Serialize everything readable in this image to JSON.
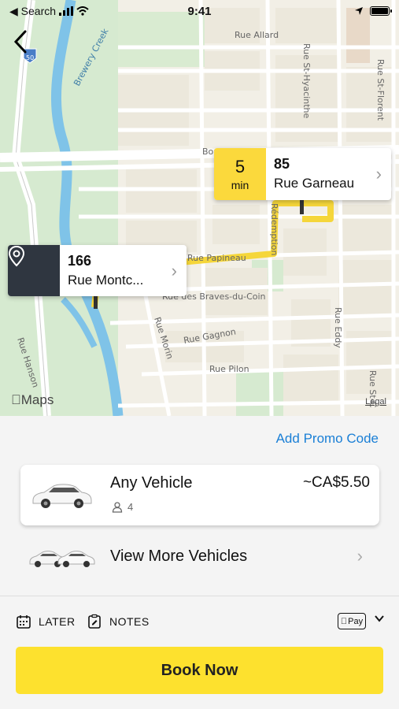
{
  "status_bar": {
    "back_label": "◀ Search",
    "time": "9:41"
  },
  "map": {
    "streets": [
      "Rue Allard",
      "Brewery Creek",
      "Rue St-Hyacinthe",
      "Rue St-Florent",
      "Rue Papineau",
      "Rue des Braves-du-Coin",
      "Rue Gagnon",
      "Rue Pilon",
      "Rue Morin",
      "Rue Hanson",
      "Rue Eddy",
      "Rue St-C",
      "Rédemption",
      "Boul"
    ],
    "highway_shield": "50",
    "maps_logo": "Maps",
    "legal": "Legal",
    "destination": {
      "eta_value": "5",
      "eta_unit": "min",
      "number": "85",
      "street": "Rue Garneau"
    },
    "pickup": {
      "number": "166",
      "street": "Rue Montc..."
    }
  },
  "sheet": {
    "promo_label": "Add Promo Code",
    "vehicle": {
      "name": "Any Vehicle",
      "price": "~CA$5.50",
      "seats": "4"
    },
    "more_label": "View More Vehicles",
    "options": {
      "later": "LATER",
      "notes": "NOTES",
      "pay": "Pay"
    },
    "book_label": "Book Now"
  },
  "colors": {
    "accent_yellow": "#fde12e",
    "route_yellow": "#f5d63a",
    "pickup_dark": "#2f3640",
    "link_blue": "#1a7fd6"
  }
}
